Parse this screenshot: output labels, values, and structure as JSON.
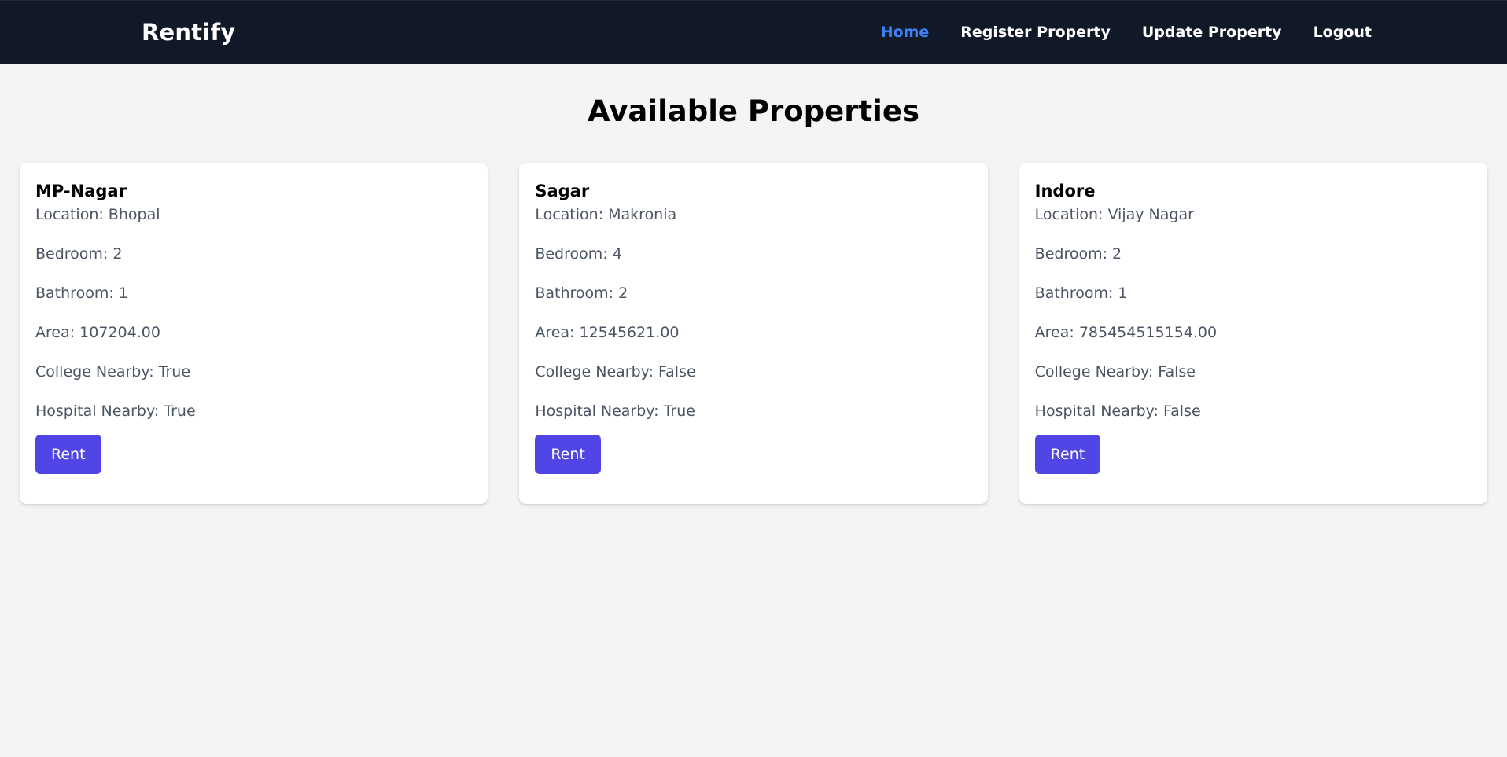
{
  "nav": {
    "brand": "Rentify",
    "links": [
      {
        "label": "Home",
        "active": true
      },
      {
        "label": "Register Property",
        "active": false
      },
      {
        "label": "Update Property",
        "active": false
      },
      {
        "label": "Logout",
        "active": false
      }
    ]
  },
  "page": {
    "title": "Available Properties"
  },
  "properties": [
    {
      "name": "MP-Nagar",
      "location": "Location: Bhopal",
      "bedroom": "Bedroom: 2",
      "bathroom": "Bathroom: 1",
      "area": "Area: 107204.00",
      "college": "College Nearby: True",
      "hospital": "Hospital Nearby: True",
      "button": "Rent"
    },
    {
      "name": "Sagar",
      "location": "Location: Makronia",
      "bedroom": "Bedroom: 4",
      "bathroom": "Bathroom: 2",
      "area": "Area: 12545621.00",
      "college": "College Nearby: False",
      "hospital": "Hospital Nearby: True",
      "button": "Rent"
    },
    {
      "name": "Indore",
      "location": "Location: Vijay Nagar",
      "bedroom": "Bedroom: 2",
      "bathroom": "Bathroom: 1",
      "area": "Area: 785454515154.00",
      "college": "College Nearby: False",
      "hospital": "Hospital Nearby: False",
      "button": "Rent"
    }
  ],
  "colors": {
    "navbar_bg": "#111827",
    "active_link": "#3b82f6",
    "page_bg": "#f3f4f6",
    "button_bg": "#4f46e5",
    "text_muted": "#4b5563"
  }
}
